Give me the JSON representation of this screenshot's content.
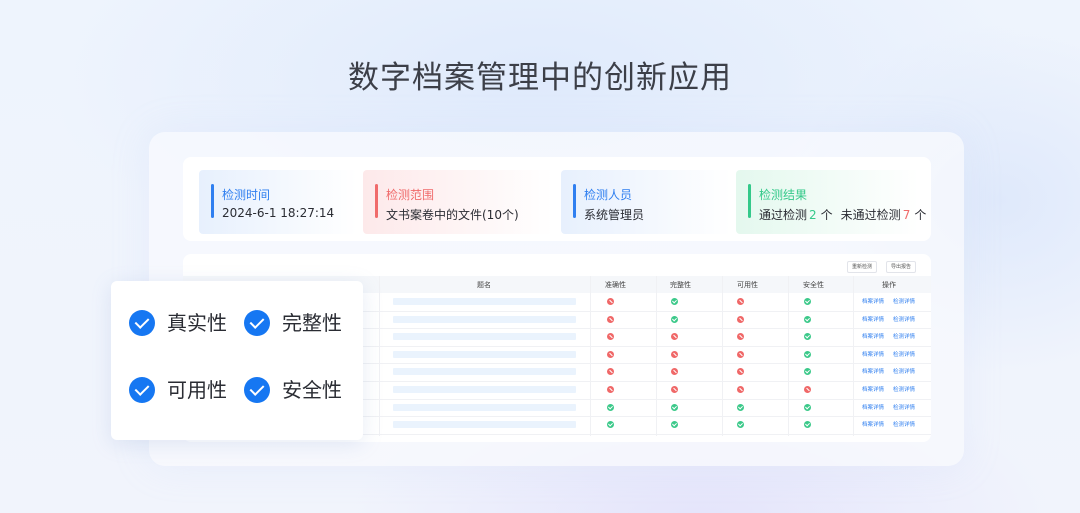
{
  "title": "数字档案管理中的创新应用",
  "info": {
    "time": {
      "label": "检测时间",
      "value": "2024-6-1  18:27:14"
    },
    "scope": {
      "label": "检测范围",
      "value": "文书案卷中的文件(10个)"
    },
    "person": {
      "label": "检测人员",
      "value": "系统管理员"
    },
    "result": {
      "label": "检测结果",
      "pass_prefix": "通过检测",
      "pass_count": "2",
      "pass_unit": "个",
      "fail_prefix": "未通过检测",
      "fail_count": "7",
      "fail_unit": "个"
    }
  },
  "table": {
    "buttons": [
      "重新检测",
      "导出报告"
    ],
    "columns": [
      "题名",
      "准确性",
      "完整性",
      "可用性",
      "安全性",
      "操作"
    ],
    "rows": [
      {
        "accuracy": "bad",
        "integrity": "ok",
        "usability": "bad",
        "security": "ok",
        "actions": [
          "档案详情",
          "检测详情"
        ]
      },
      {
        "accuracy": "bad",
        "integrity": "ok",
        "usability": "bad",
        "security": "ok",
        "actions": [
          "档案详情",
          "检测详情"
        ]
      },
      {
        "accuracy": "bad",
        "integrity": "bad",
        "usability": "bad",
        "security": "ok",
        "actions": [
          "档案详情",
          "检测详情"
        ]
      },
      {
        "accuracy": "bad",
        "integrity": "bad",
        "usability": "bad",
        "security": "ok",
        "actions": [
          "档案详情",
          "检测详情"
        ]
      },
      {
        "accuracy": "bad",
        "integrity": "bad",
        "usability": "bad",
        "security": "ok",
        "actions": [
          "档案详情",
          "检测详情"
        ]
      },
      {
        "accuracy": "bad",
        "integrity": "bad",
        "usability": "bad",
        "security": "bad",
        "actions": [
          "档案详情",
          "检测详情"
        ]
      },
      {
        "accuracy": "ok",
        "integrity": "ok",
        "usability": "ok",
        "security": "ok",
        "actions": [
          "档案详情",
          "检测详情"
        ]
      },
      {
        "accuracy": "ok",
        "integrity": "ok",
        "usability": "ok",
        "security": "ok",
        "actions": [
          "档案详情",
          "检测详情"
        ]
      }
    ]
  },
  "features": [
    "真实性",
    "完整性",
    "可用性",
    "安全性"
  ],
  "colors": {
    "accent": "#1677f2",
    "pass": "#34c98a",
    "fail": "#f06b6b"
  }
}
